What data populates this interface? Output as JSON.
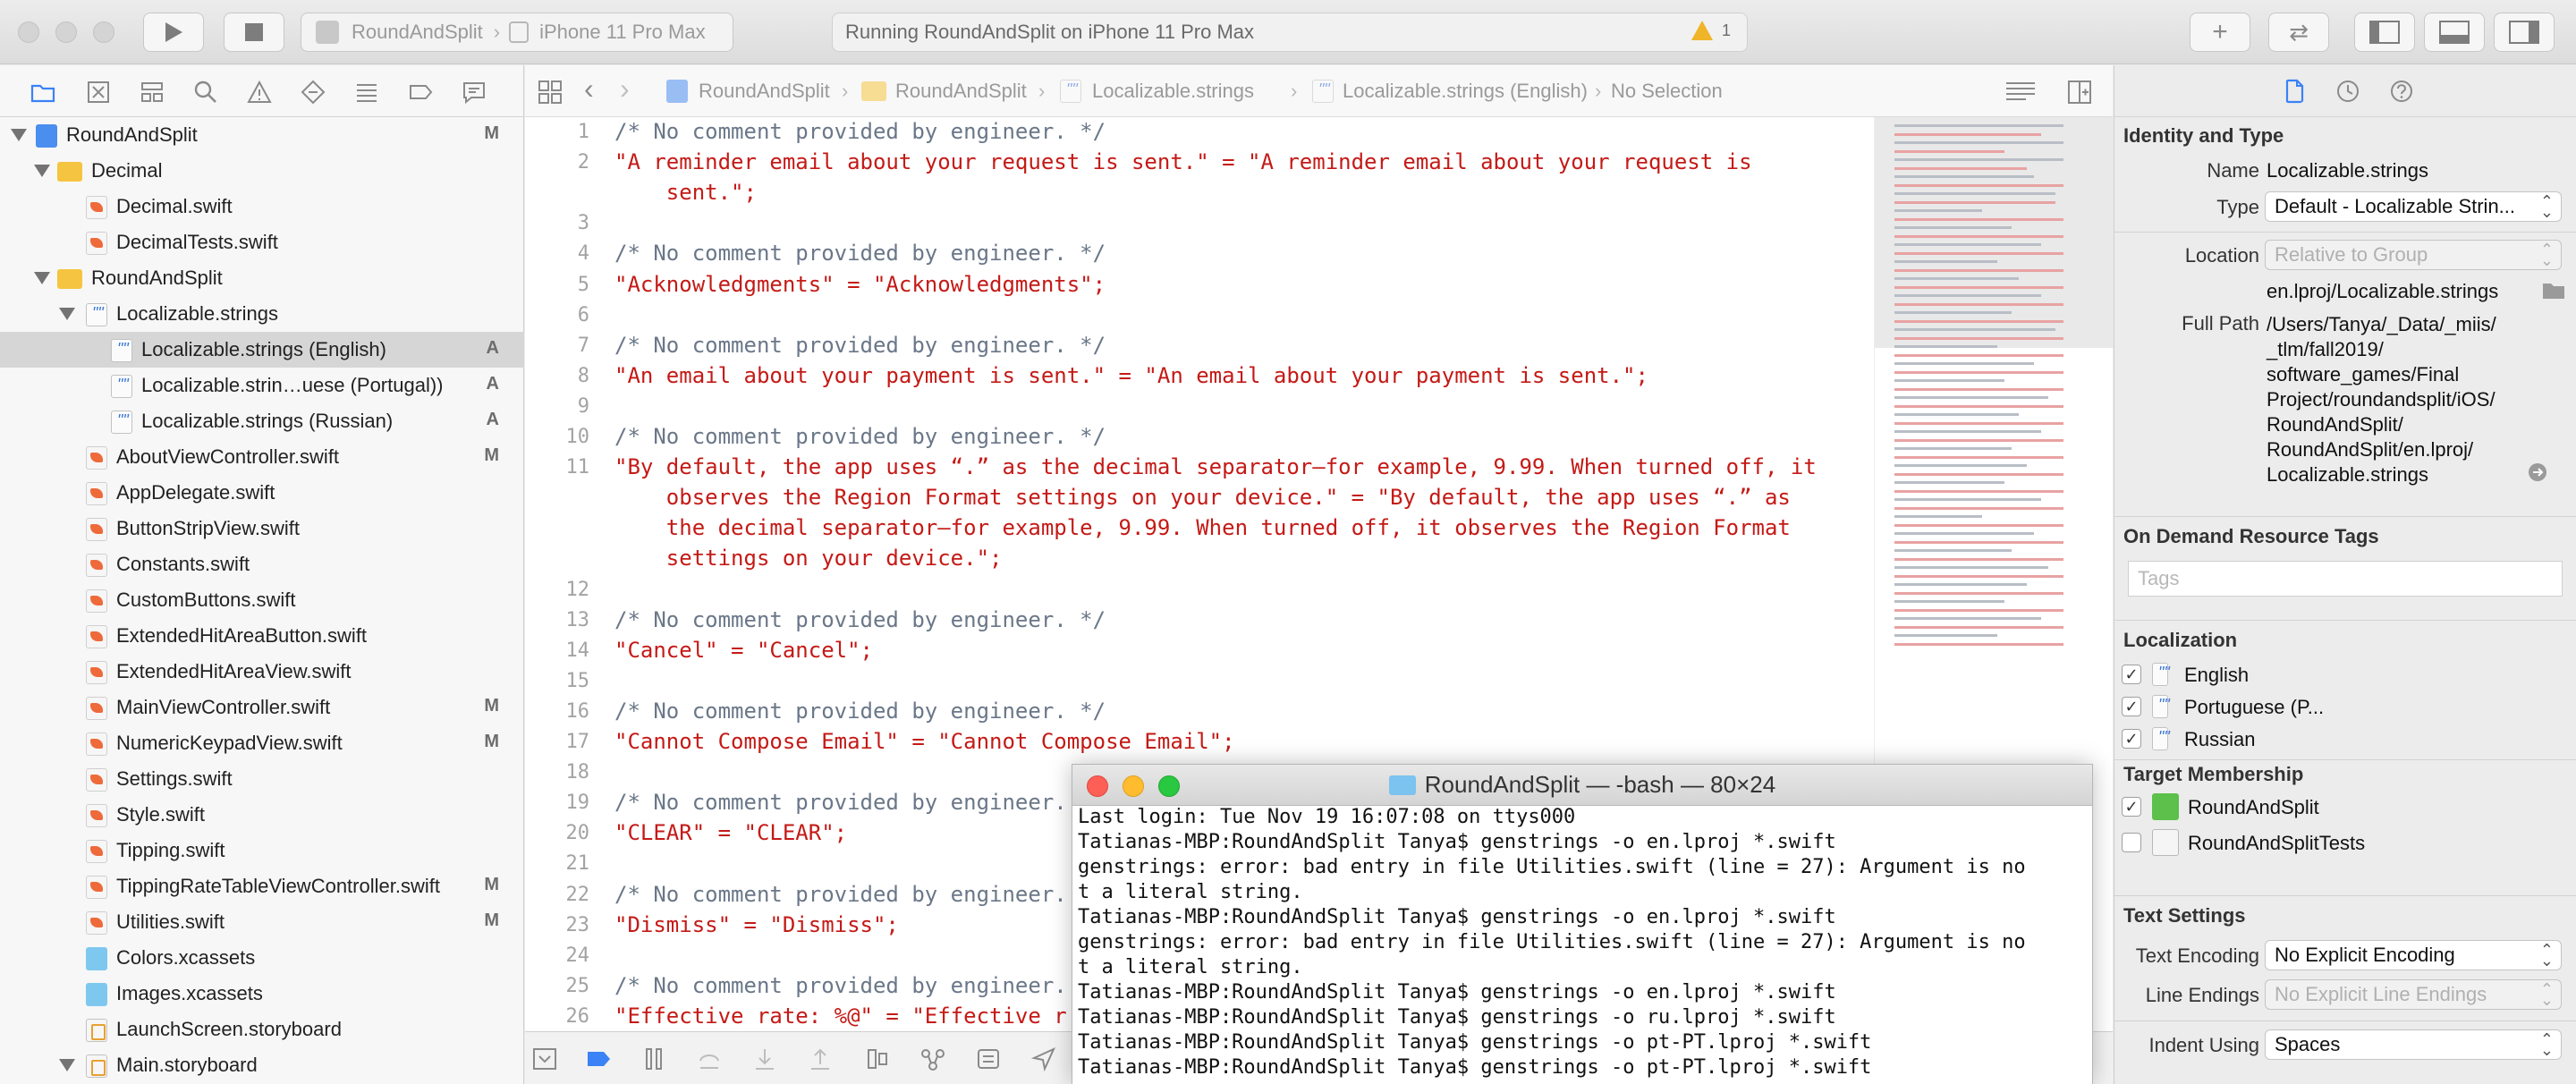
{
  "toolbar": {
    "scheme": "RoundAndSplit",
    "device": "iPhone 11 Pro Max",
    "status": "Running RoundAndSplit on iPhone 11 Pro Max",
    "warnings": "1"
  },
  "navigator": {
    "items": [
      {
        "label": "RoundAndSplit",
        "badge": "M"
      },
      {
        "label": "Decimal",
        "badge": ""
      },
      {
        "label": "Decimal.swift",
        "badge": ""
      },
      {
        "label": "DecimalTests.swift",
        "badge": ""
      },
      {
        "label": "RoundAndSplit",
        "badge": ""
      },
      {
        "label": "Localizable.strings",
        "badge": ""
      },
      {
        "label": "Localizable.strings (English)",
        "badge": "A"
      },
      {
        "label": "Localizable.strin…uese (Portugal))",
        "badge": "A"
      },
      {
        "label": "Localizable.strings (Russian)",
        "badge": "A"
      },
      {
        "label": "AboutViewController.swift",
        "badge": "M"
      },
      {
        "label": "AppDelegate.swift",
        "badge": ""
      },
      {
        "label": "ButtonStripView.swift",
        "badge": ""
      },
      {
        "label": "Constants.swift",
        "badge": ""
      },
      {
        "label": "CustomButtons.swift",
        "badge": ""
      },
      {
        "label": "ExtendedHitAreaButton.swift",
        "badge": ""
      },
      {
        "label": "ExtendedHitAreaView.swift",
        "badge": ""
      },
      {
        "label": "MainViewController.swift",
        "badge": "M"
      },
      {
        "label": "NumericKeypadView.swift",
        "badge": "M"
      },
      {
        "label": "Settings.swift",
        "badge": ""
      },
      {
        "label": "Style.swift",
        "badge": ""
      },
      {
        "label": "Tipping.swift",
        "badge": ""
      },
      {
        "label": "TippingRateTableViewController.swift",
        "badge": "M"
      },
      {
        "label": "Utilities.swift",
        "badge": "M"
      },
      {
        "label": "Colors.xcassets",
        "badge": ""
      },
      {
        "label": "Images.xcassets",
        "badge": ""
      },
      {
        "label": "LaunchScreen.storyboard",
        "badge": ""
      },
      {
        "label": "Main.storyboard",
        "badge": ""
      }
    ]
  },
  "jumpbar": {
    "crumbs": [
      "RoundAndSplit",
      "RoundAndSplit",
      "Localizable.strings",
      "Localizable.strings (English)",
      "No Selection"
    ]
  },
  "code": {
    "lines": [
      {
        "n": "1",
        "text": "/* No comment provided by engineer. */"
      },
      {
        "n": "2",
        "text": "\"A reminder email about your request is sent.\" = \"A reminder email about your request is"
      },
      {
        "n": "",
        "text": "    sent.\";"
      },
      {
        "n": "3",
        "text": ""
      },
      {
        "n": "4",
        "text": "/* No comment provided by engineer. */"
      },
      {
        "n": "5",
        "text": "\"Acknowledgments\" = \"Acknowledgments\";"
      },
      {
        "n": "6",
        "text": ""
      },
      {
        "n": "7",
        "text": "/* No comment provided by engineer. */"
      },
      {
        "n": "8",
        "text": "\"An email about your payment is sent.\" = \"An email about your payment is sent.\";"
      },
      {
        "n": "9",
        "text": ""
      },
      {
        "n": "10",
        "text": "/* No comment provided by engineer. */"
      },
      {
        "n": "11",
        "text": "\"By default, the app uses “.” as the decimal separator—for example, 9.99. When turned off, it"
      },
      {
        "n": "",
        "text": "    observes the Region Format settings on your device.\" = \"By default, the app uses “.” as"
      },
      {
        "n": "",
        "text": "    the decimal separator—for example, 9.99. When turned off, it observes the Region Format"
      },
      {
        "n": "",
        "text": "    settings on your device.\";"
      },
      {
        "n": "12",
        "text": ""
      },
      {
        "n": "13",
        "text": "/* No comment provided by engineer. */"
      },
      {
        "n": "14",
        "text": "\"Cancel\" = \"Cancel\";"
      },
      {
        "n": "15",
        "text": ""
      },
      {
        "n": "16",
        "text": "/* No comment provided by engineer. */"
      },
      {
        "n": "17",
        "text": "\"Cannot Compose Email\" = \"Cannot Compose Email\";"
      },
      {
        "n": "18",
        "text": ""
      },
      {
        "n": "19",
        "text": "/* No comment provided by engineer."
      },
      {
        "n": "20",
        "text": "\"CLEAR\" = \"CLEAR\";"
      },
      {
        "n": "21",
        "text": ""
      },
      {
        "n": "22",
        "text": "/* No comment provided by engineer."
      },
      {
        "n": "23",
        "text": "\"Dismiss\" = \"Dismiss\";"
      },
      {
        "n": "24",
        "text": ""
      },
      {
        "n": "25",
        "text": "/* No comment provided by engineer."
      },
      {
        "n": "26",
        "text": "\"Effective rate: %@\" = \"Effective r"
      }
    ]
  },
  "terminal": {
    "title": "RoundAndSplit — -bash — 80×24",
    "lines": [
      "Last login: Tue Nov 19 16:07:08 on ttys000",
      "Tatianas-MBP:RoundAndSplit Tanya$ genstrings -o en.lproj *.swift",
      "genstrings: error: bad entry in file Utilities.swift (line = 27): Argument is no",
      "t a literal string.",
      "Tatianas-MBP:RoundAndSplit Tanya$ genstrings -o en.lproj *.swift",
      "genstrings: error: bad entry in file Utilities.swift (line = 27): Argument is no",
      "t a literal string.",
      "Tatianas-MBP:RoundAndSplit Tanya$ genstrings -o en.lproj *.swift",
      "Tatianas-MBP:RoundAndSplit Tanya$ genstrings -o ru.lproj *.swift",
      "Tatianas-MBP:RoundAndSplit Tanya$ genstrings -o pt-PT.lproj *.swift",
      "Tatianas-MBP:RoundAndSplit Tanya$ genstrings -o pt-PT.lproj *.swift"
    ]
  },
  "inspector": {
    "identity_head": "Identity and Type",
    "name_label": "Name",
    "name_value": "Localizable.strings",
    "type_label": "Type",
    "type_value": "Default - Localizable Strin...",
    "location_label": "Location",
    "location_value": "Relative to Group",
    "location_path": "en.lproj/Localizable.strings",
    "fullpath_label": "Full Path",
    "fullpath_lines": [
      "/Users/Tanya/_Data/_miis/",
      "_tlm/fall2019/",
      "software_games/Final",
      "Project/roundandsplit/iOS/",
      "RoundAndSplit/",
      "RoundAndSplit/en.lproj/",
      "Localizable.strings"
    ],
    "ondemand_head": "On Demand Resource Tags",
    "tags_placeholder": "Tags",
    "localization_head": "Localization",
    "localizations": [
      "English",
      "Portuguese (P...",
      "Russian"
    ],
    "target_head": "Target Membership",
    "targets": [
      "RoundAndSplit",
      "RoundAndSplitTests"
    ],
    "text_head": "Text Settings",
    "encoding_label": "Text Encoding",
    "encoding_value": "No Explicit Encoding",
    "endings_label": "Line Endings",
    "endings_value": "No Explicit Line Endings",
    "indent_label": "Indent Using",
    "indent_value": "Spaces"
  },
  "colors": {
    "string": "#c41a16",
    "comment": "#6a7788",
    "selection": "#d6d6d6",
    "target_icon": "#5cc04a"
  }
}
